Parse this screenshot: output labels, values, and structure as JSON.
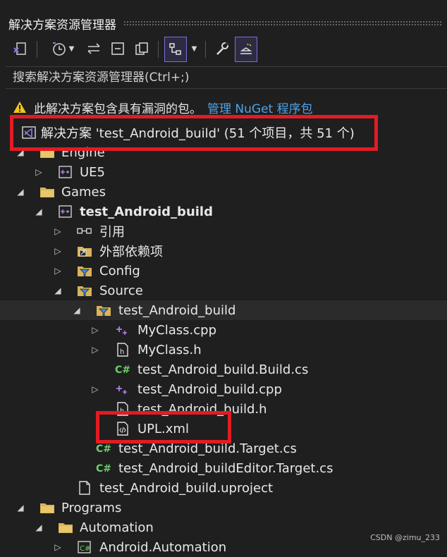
{
  "panel": {
    "title": "解决方案资源管理器"
  },
  "search": {
    "placeholder": "搜索解决方案资源管理器(Ctrl+;)"
  },
  "warning": {
    "message": "此解决方案包含具有漏洞的包。",
    "link": "管理 NuGet 程序包"
  },
  "solution": {
    "label": "解决方案 'test_Android_build' (51 个项目，共 51 个)"
  },
  "tree": [
    {
      "label": "Engine",
      "icon": "folder-icon"
    },
    {
      "label": "UE5",
      "icon": "cpp-project-icon"
    },
    {
      "label": "Games",
      "icon": "folder-icon"
    },
    {
      "label": "test_Android_build",
      "icon": "cpp-project-icon"
    },
    {
      "label": "引用",
      "icon": "references-icon"
    },
    {
      "label": "外部依赖项",
      "icon": "external-dependencies-icon"
    },
    {
      "label": "Config",
      "icon": "filter-folder-icon"
    },
    {
      "label": "Source",
      "icon": "filter-folder-icon"
    },
    {
      "label": "test_Android_build",
      "icon": "filter-folder-icon"
    },
    {
      "label": "MyClass.cpp",
      "icon": "cpp-file-icon"
    },
    {
      "label": "MyClass.h",
      "icon": "header-file-icon"
    },
    {
      "label": "test_Android_build.Build.cs",
      "icon": "csharp-file-icon"
    },
    {
      "label": "test_Android_build.cpp",
      "icon": "cpp-file-icon"
    },
    {
      "label": "test_Android_build.h",
      "icon": "header-file-icon"
    },
    {
      "label": "UPL.xml",
      "icon": "xml-file-icon"
    },
    {
      "label": "test_Android_build.Target.cs",
      "icon": "csharp-file-icon"
    },
    {
      "label": "test_Android_buildEditor.Target.cs",
      "icon": "csharp-file-icon"
    },
    {
      "label": "test_Android_build.uproject",
      "icon": "file-icon"
    },
    {
      "label": "Programs",
      "icon": "folder-icon"
    },
    {
      "label": "Automation",
      "icon": "folder-icon"
    },
    {
      "label": "Android.Automation",
      "icon": "csharp-project-icon"
    }
  ],
  "watermark": "CSDN @zimu_233",
  "colors": {
    "accent": "#7b6ee0",
    "link": "#4fa3e8",
    "highlight": "#e31b23",
    "warning": "#f0c419"
  }
}
